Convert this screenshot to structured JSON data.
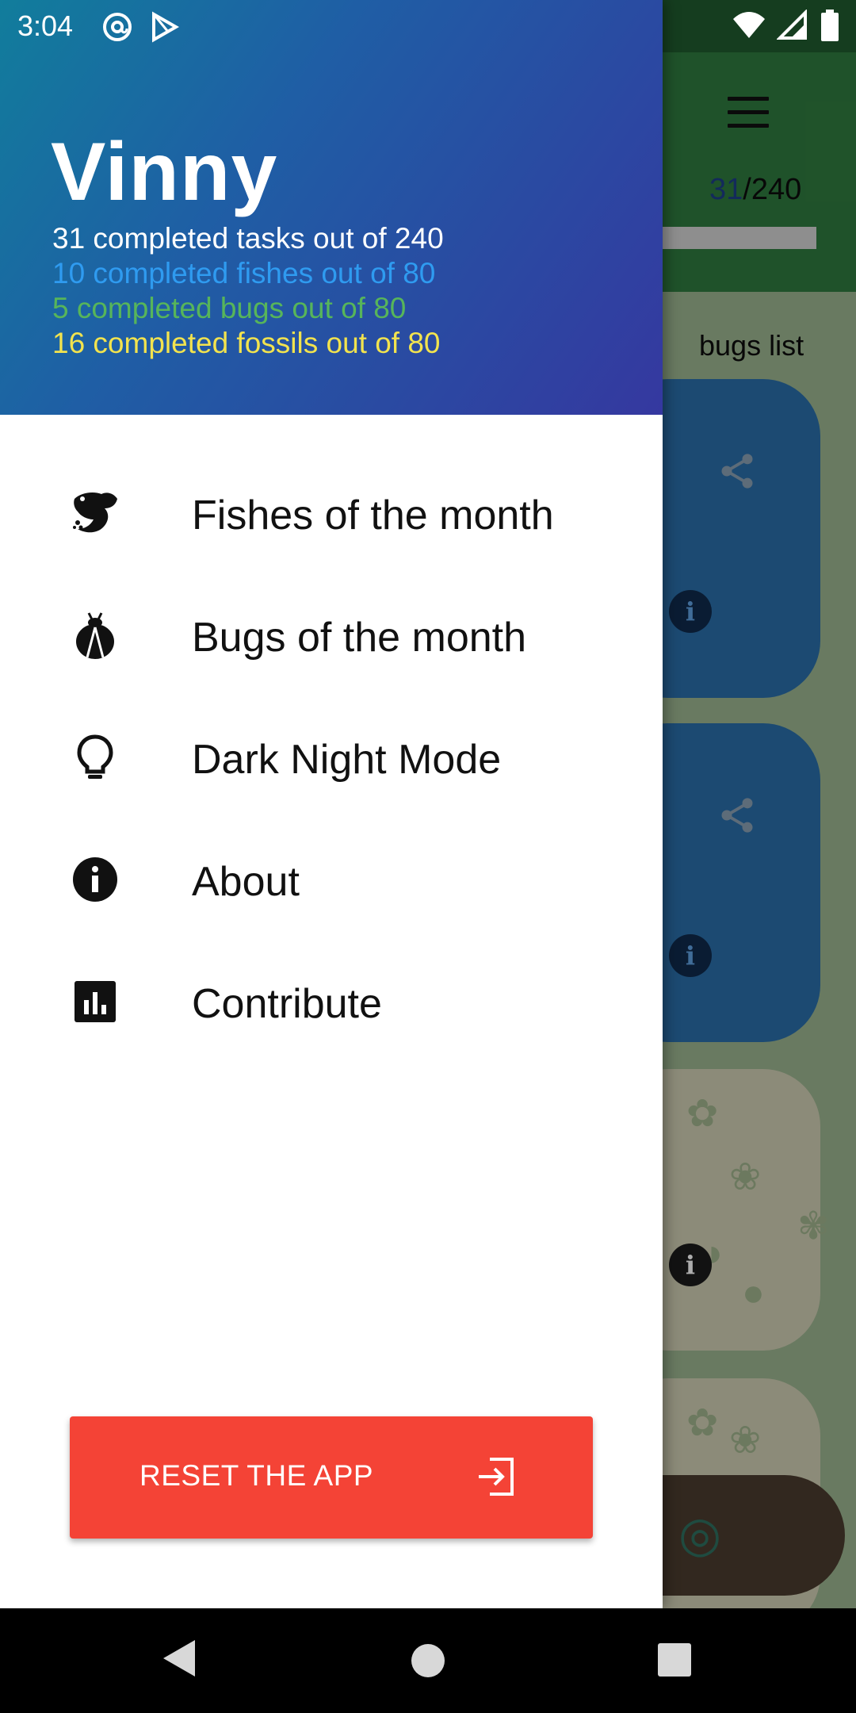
{
  "status_bar": {
    "time": "3:04",
    "left_icons": [
      "at-sign-icon",
      "play-store-icon"
    ],
    "right_icons": [
      "wifi-icon",
      "signal-icon",
      "battery-icon"
    ]
  },
  "background_app": {
    "counter_done": "31",
    "counter_total": "/240",
    "bugs_list_label": "bugs list",
    "colors": {
      "toolbar": "#2f7a3e",
      "card_blue": "#2a6ea8",
      "card_tan": "#cfcdb3"
    }
  },
  "drawer": {
    "user_name": "Vinny",
    "stats": {
      "tasks": "31 completed tasks out of 240",
      "fishes": "10 completed fishes out of 80",
      "bugs": "5 completed bugs out of 80",
      "fossils": "16 completed fossils out of 80"
    },
    "stat_colors": {
      "tasks": "#ffffff",
      "fishes": "#2f9bf0",
      "bugs": "#57b55a",
      "fossils": "#f2e34e"
    },
    "menu": [
      {
        "label": "Fishes of the month",
        "icon": "fish-icon"
      },
      {
        "label": "Bugs of the month",
        "icon": "bug-icon"
      },
      {
        "label": "Dark Night Mode",
        "icon": "lightbulb-icon"
      },
      {
        "label": "About",
        "icon": "info-icon"
      },
      {
        "label": "Contribute",
        "icon": "chart-icon"
      }
    ],
    "reset_button": {
      "label": "RESET THE APP",
      "icon": "exit-icon",
      "color": "#f44336"
    }
  },
  "nav_bar": {
    "buttons": [
      "back-icon",
      "home-icon",
      "recents-icon"
    ]
  }
}
